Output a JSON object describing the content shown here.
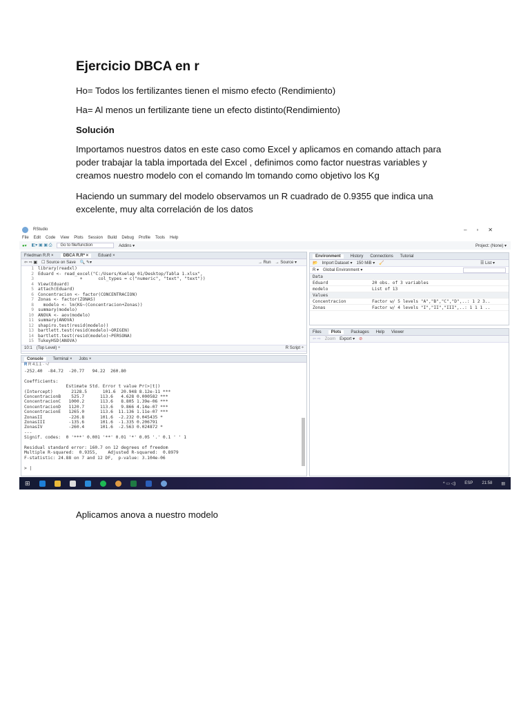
{
  "title": "Ejercicio DBCA en r",
  "ho": "Ho= Todos los fertilizantes tienen el mismo efecto (Rendimiento)",
  "ha": "Ha= Al menos un fertilizante tiene un efecto distinto(Rendimiento)",
  "solucion": "Solución",
  "p1": " Importamos nuestros datos en este caso como Excel y aplicamos en comando attach para poder trabajar la tabla importada del Excel , definimos como factor nuestras variables y creamos nuestro modelo con el comando lm tomando como objetivo los Kg",
  "p2": "Haciendo un summary del modelo observamos un R cuadrado de 0.9355 que indica una excelente, muy alta correlación de los datos",
  "p3": "Aplicamos anova a nuestro modelo",
  "rstudio": {
    "window_title": "RStudio",
    "menu": [
      "File",
      "Edit",
      "Code",
      "View",
      "Plots",
      "Session",
      "Build",
      "Debug",
      "Profile",
      "Tools",
      "Help"
    ],
    "goto": "Go to file/function",
    "addins": "Addins ▾",
    "project": "Project: (None) ▾",
    "source_tabs": [
      "Friedman R.R ×",
      "DBCA R.R* ×",
      "Eduard ×"
    ],
    "source_on_save": "Source on Save",
    "run": "→ Run",
    "source_btn": "→ Source ▾",
    "code": [
      "library(readxl)",
      "Eduard <- read_excel(\"C:/Users/Kuelap 01/Desktop/Tabla 1.xlsx\",",
      "                +      col_types = c(\"numeric\", \"text\", \"text\"))",
      "View(Eduard)",
      "attach(Eduard)",
      "Concentracion <- factor(CONCENTRACION)",
      "Zonas <- factor(ZONAS)",
      "  modelo <- lm(KG~(Concentracion+Zonas))",
      "summary(modelo)",
      "ANOVA <- aov(modelo)",
      "summary(ANOVA)",
      "shapiro.test(resid(modelo))",
      "bartlett.test(resid(modelo)~ORIGEN)",
      "bartlett.test(resid(modelo)~PERSONA)",
      "TukeyHSD(ANOVA)"
    ],
    "status_pos": "10:1",
    "status_level": "(Top Level) ÷",
    "status_type": "R Script ÷",
    "console_tabs": [
      "Console",
      "Terminal ×",
      "Jobs ×"
    ],
    "console_path": "R 4.1.1 · ~/",
    "console": [
      "-252.40  -84.72  -20.77   94.22  260.80",
      "",
      "Coefficients:",
      "                Estimate Std. Error t value Pr(>|t|)",
      "(Intercept)       2128.5      101.6  20.948 8.12e-11 ***",
      "ConcentracionB    525.7      113.6   4.628 0.000582 ***",
      "ConcentracionC   1000.2      113.6   8.805 1.39e-06 ***",
      "ConcentracionD   1120.7      113.6   9.866 4.14e-07 ***",
      "ConcentracionE   1265.0      113.6  11.136 1.11e-07 ***",
      "ZonasII          -226.8      101.6  -2.232 0.045435 *",
      "ZonasIII         -135.6      101.6  -1.335 0.206791",
      "ZonasIV          -260.4      101.6  -2.563 0.024872 *",
      "---",
      "Signif. codes:  0 '***' 0.001 '**' 0.01 '*' 0.05 '.' 0.1 ' ' 1",
      "",
      "Residual standard error: 160.7 on 12 degrees of freedom",
      "Multiple R-squared:  0.9355,\tAdjusted R-squared:  0.8979",
      "F-statistic: 24.88 on 7 and 12 DF,  p-value: 3.104e-06",
      "",
      "> |"
    ],
    "env_tabs": [
      "Environment",
      "History",
      "Connections",
      "Tutorial"
    ],
    "import_dataset": "Import Dataset ▾",
    "memory": "150 MiB ▾",
    "list_btn": "☰ List ▾",
    "r_sel": "R ▾",
    "global_env": "Global Environment ▾",
    "data_hdr": "Data",
    "values_hdr": "Values",
    "env_data": [
      {
        "name": "Eduard",
        "value": "20 obs. of 3 variables"
      },
      {
        "name": "modelo",
        "value": "List of  13"
      }
    ],
    "env_values": [
      {
        "name": "Concentracion",
        "value": "Factor w/ 5 levels \"A\",\"B\",\"C\",\"D\",..: 1 2 3.."
      },
      {
        "name": "Zonas",
        "value": "Factor w/ 4 levels \"I\",\"II\",\"III\",..: 1 1 1 .."
      }
    ],
    "files_tabs": [
      "Files",
      "Plots",
      "Packages",
      "Help",
      "Viewer"
    ],
    "zoom": "Zoom",
    "export": "Export ▾",
    "tray": {
      "lang": "ESP",
      "time": "21:58"
    }
  }
}
